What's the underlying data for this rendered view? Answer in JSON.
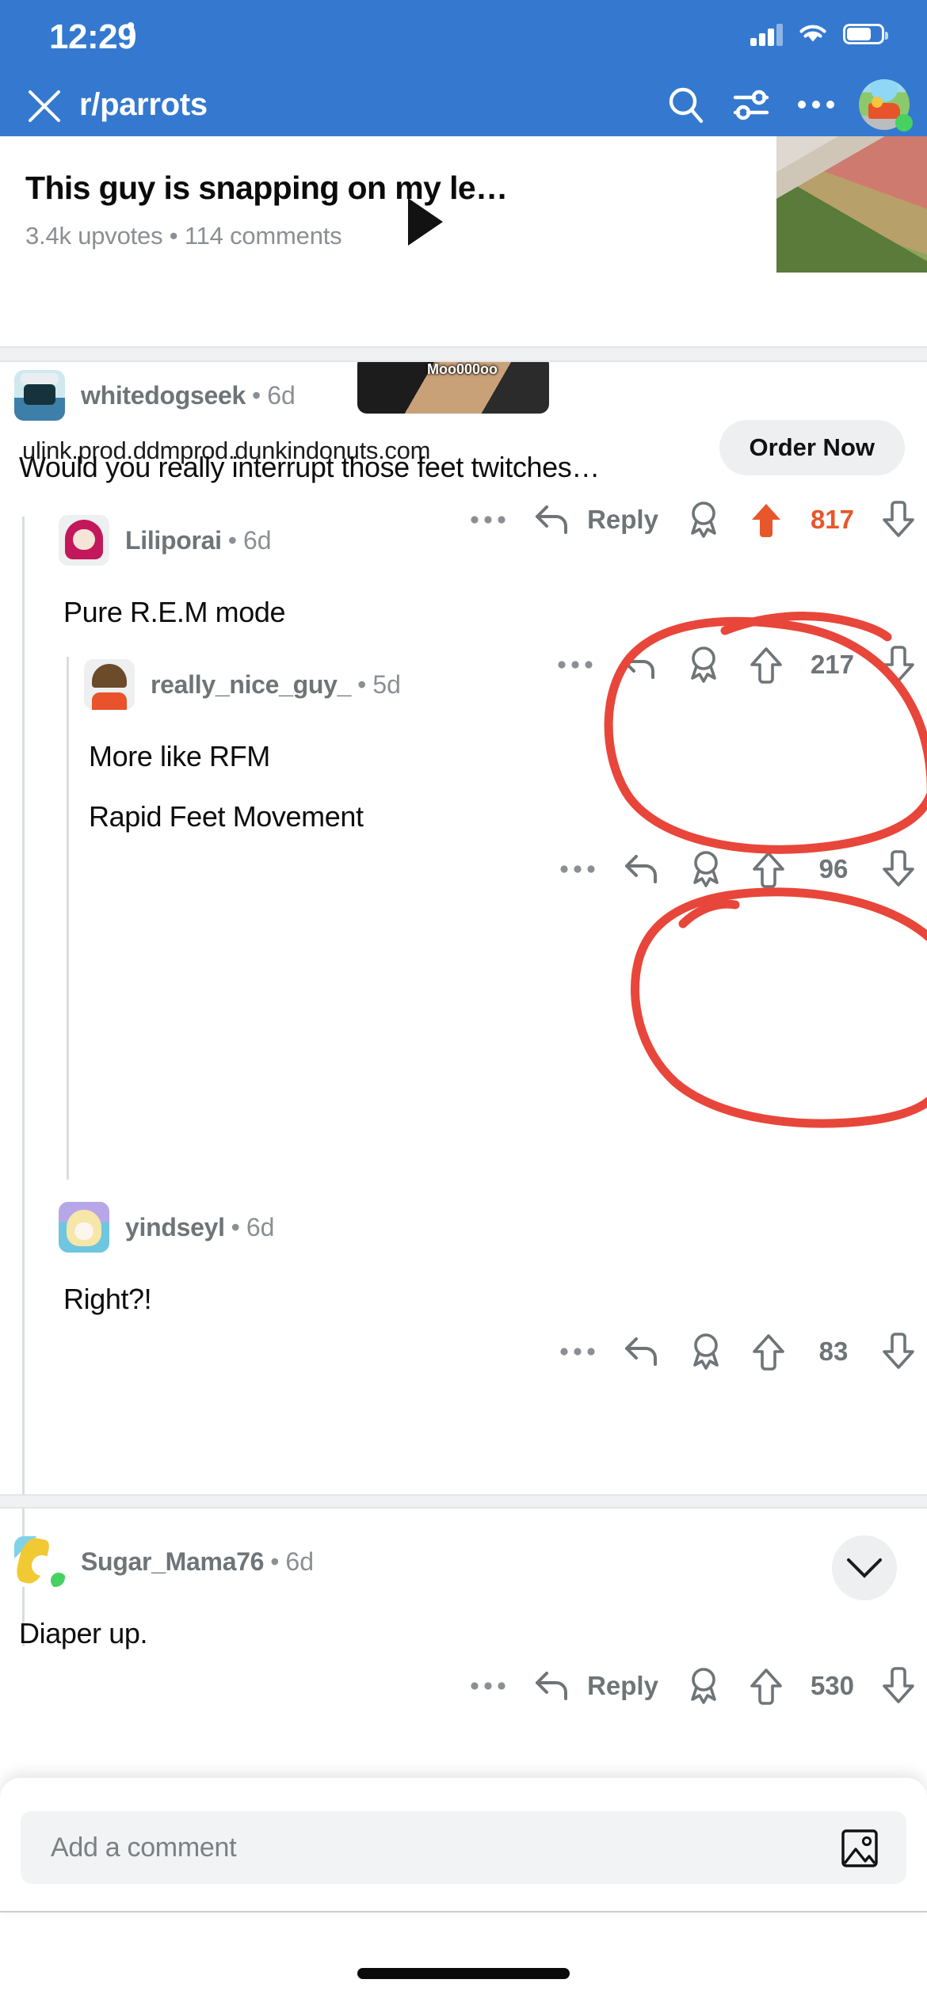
{
  "status_bar": {
    "time": "12:29",
    "location_icon": "location-arrow-icon",
    "signal_icon": "cellular-signal-icon",
    "wifi_icon": "wifi-icon",
    "battery_icon": "battery-icon"
  },
  "nav": {
    "close_icon": "close-icon",
    "title": "r/parrots",
    "search_icon": "search-icon",
    "sort_icon": "sort-filter-icon",
    "overflow_icon": "more-options-icon",
    "avatar_icon": "user-avatar"
  },
  "post_preview": {
    "title": "This guy is snapping on my le…",
    "meta": "3.4k upvotes • 114 comments",
    "play_icon": "play-icon",
    "thumbnail_icon": "post-thumbnail"
  },
  "ad": {
    "media_caption": "Moo000oo",
    "url": "ulink.prod.ddmprod.dunkindonuts.com",
    "cta_label": "Order Now"
  },
  "comments": [
    {
      "user": "whitedogseek",
      "dot": "•",
      "time": "6d",
      "body": [
        "Would you really interrupt those feet twitches…"
      ],
      "reply_label": "Reply",
      "score": "817",
      "upvoted": true,
      "avatar": "av-robot",
      "online": false,
      "depth": 0
    },
    {
      "user": "Liliporai",
      "dot": "•",
      "time": "6d",
      "body": [
        "Pure R.E.M mode"
      ],
      "reply_label": "",
      "score": "217",
      "upvoted": false,
      "avatar": "av-girl",
      "online": false,
      "depth": 1
    },
    {
      "user": "really_nice_guy_",
      "dot": "•",
      "time": "5d",
      "body": [
        "More like RFM",
        "Rapid Feet Movement"
      ],
      "reply_label": "",
      "score": "96",
      "upvoted": false,
      "avatar": "av-guy",
      "online": false,
      "depth": 2
    },
    {
      "user": "yindseyl",
      "dot": "•",
      "time": "6d",
      "body": [
        "Right?!"
      ],
      "reply_label": "",
      "score": "83",
      "upvoted": false,
      "avatar": "av-anime",
      "online": false,
      "depth": 1
    },
    {
      "user": "Sugar_Mama76",
      "dot": "•",
      "time": "6d",
      "body": [
        "Diaper up."
      ],
      "reply_label": "Reply",
      "score": "530",
      "upvoted": false,
      "avatar": "av-banana",
      "online": true,
      "depth": 0
    }
  ],
  "action_icons": {
    "overflow": "more-options-icon",
    "reply_arrow": "reply-arrow-icon",
    "award": "award-icon",
    "upvote": "upvote-arrow-icon",
    "downvote": "downvote-arrow-icon"
  },
  "collapse_button": {
    "icon": "chevron-down-icon"
  },
  "composer": {
    "placeholder": "Add a comment",
    "image_icon": "image-attachment-icon"
  },
  "annotations": {
    "tool": "red-marker-circle",
    "color": "#E8463A",
    "targets": [
      "817-score-circle",
      "217-score-circle"
    ]
  },
  "colors": {
    "header_blue": "#3479CF",
    "upvote_orange": "#E8562B",
    "annotation_red": "#E8463A",
    "muted_text": "#6E7477",
    "divider": "#EFF1F3"
  }
}
